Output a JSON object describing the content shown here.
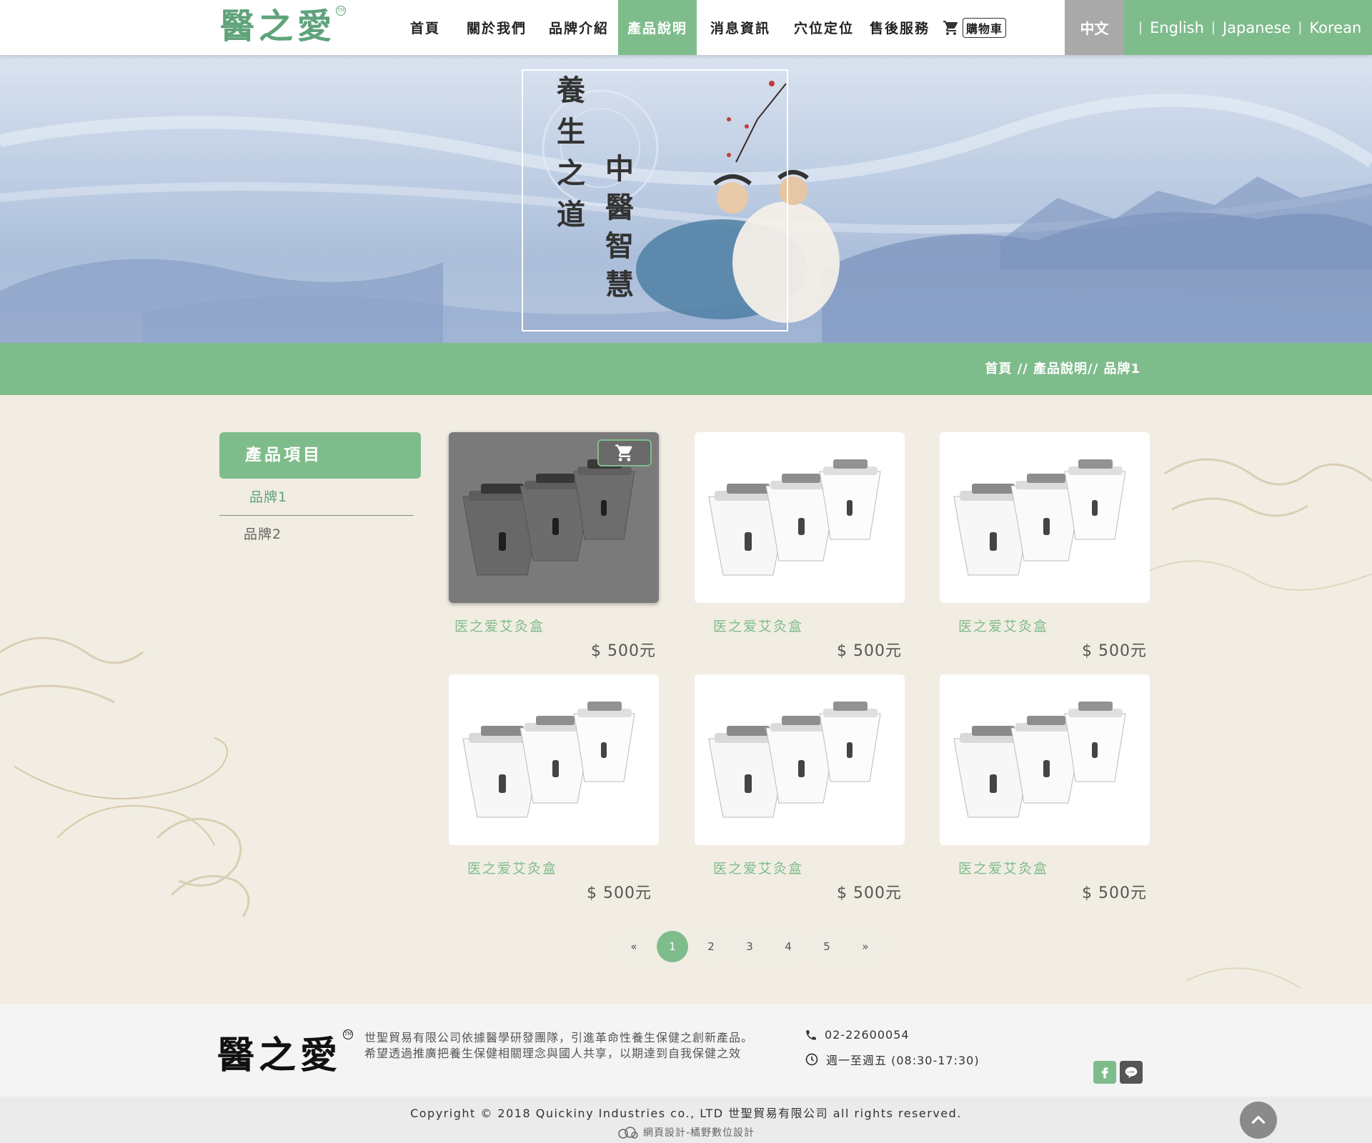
{
  "header": {
    "logo_text": "醫之愛",
    "logo_mark": "TM",
    "nav": [
      "首頁",
      "關於我們",
      "品牌介紹",
      "產品說明",
      "消息資訊",
      "穴位定位",
      "售後服務"
    ],
    "active_nav": "產品說明",
    "cart_label": "購物車",
    "cart_icon": "cart-icon",
    "languages": [
      "中文",
      "English",
      "Japanese",
      "Korean"
    ],
    "active_language": "中文"
  },
  "banner": {
    "line1": "養生之道",
    "line2": "中醫智慧"
  },
  "breadcrumb": {
    "text": "首頁 //  產品說明// 品牌1"
  },
  "sidebar": {
    "title": "產品項目",
    "items": [
      "品牌1",
      "品牌2"
    ],
    "active_item": "品牌1"
  },
  "products": [
    {
      "name": "医之爱艾灸盒",
      "price": "$ 500元",
      "hover": true
    },
    {
      "name": "医之爱艾灸盒",
      "price": "$ 500元",
      "hover": false
    },
    {
      "name": "医之爱艾灸盒",
      "price": "$ 500元",
      "hover": false
    },
    {
      "name": "医之爱艾灸盒",
      "price": "$ 500元",
      "hover": false
    },
    {
      "name": "医之爱艾灸盒",
      "price": "$ 500元",
      "hover": false
    },
    {
      "name": "医之爱艾灸盒",
      "price": "$ 500元",
      "hover": false
    }
  ],
  "pagination": {
    "prev": "«",
    "pages": [
      "1",
      "2",
      "3",
      "4",
      "5"
    ],
    "next": "»",
    "current": "1"
  },
  "footer": {
    "logo_text": "醫之愛",
    "logo_mark": "TM",
    "description": "世聖貿易有限公司依據醫學研發團隊，引進革命性養生保健之創新產品。希望透過推廣把養生保健相關理念與國人共享，以期達到自我保健之效",
    "phone": "02-22600054",
    "hours": "週一至週五 (08:30-17:30)",
    "copyright": "Copyright © 2018 Quickiny Industries co., LTD 世聖貿易有限公司 all rights reserved.",
    "credit": "網頁設計-橘野數位設計"
  },
  "colors": {
    "brand_green": "#7fbc8c",
    "lang_gray": "#a9a9a9",
    "price_text": "#555555"
  }
}
